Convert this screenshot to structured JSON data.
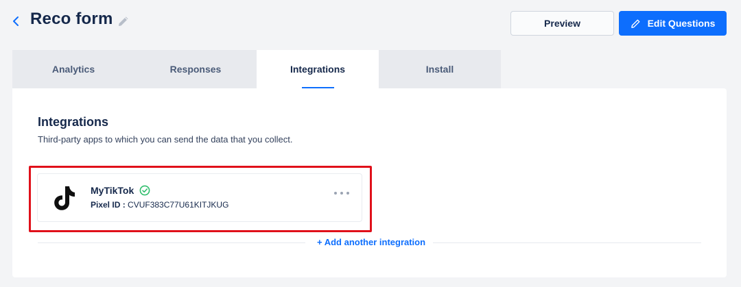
{
  "header": {
    "title": "Reco form",
    "preview_label": "Preview",
    "edit_questions_label": "Edit Questions"
  },
  "tabs": [
    {
      "label": "Analytics",
      "active": false
    },
    {
      "label": "Responses",
      "active": false
    },
    {
      "label": "Integrations",
      "active": true
    },
    {
      "label": "Install",
      "active": false
    }
  ],
  "section": {
    "title": "Integrations",
    "subtitle": "Third-party apps to which you can send the data that you collect."
  },
  "integration": {
    "name": "MyTikTok",
    "icon": "tiktok-icon",
    "status_icon": "verified-check-icon",
    "pixel_label": "Pixel ID :",
    "pixel_id": "CVUF383C77U61KITJKUG"
  },
  "add_integration_label": "+ Add another integration",
  "colors": {
    "accent": "#0d6efd",
    "highlight": "#e0101a",
    "verified": "#2ebd6b",
    "title": "#15284b"
  }
}
